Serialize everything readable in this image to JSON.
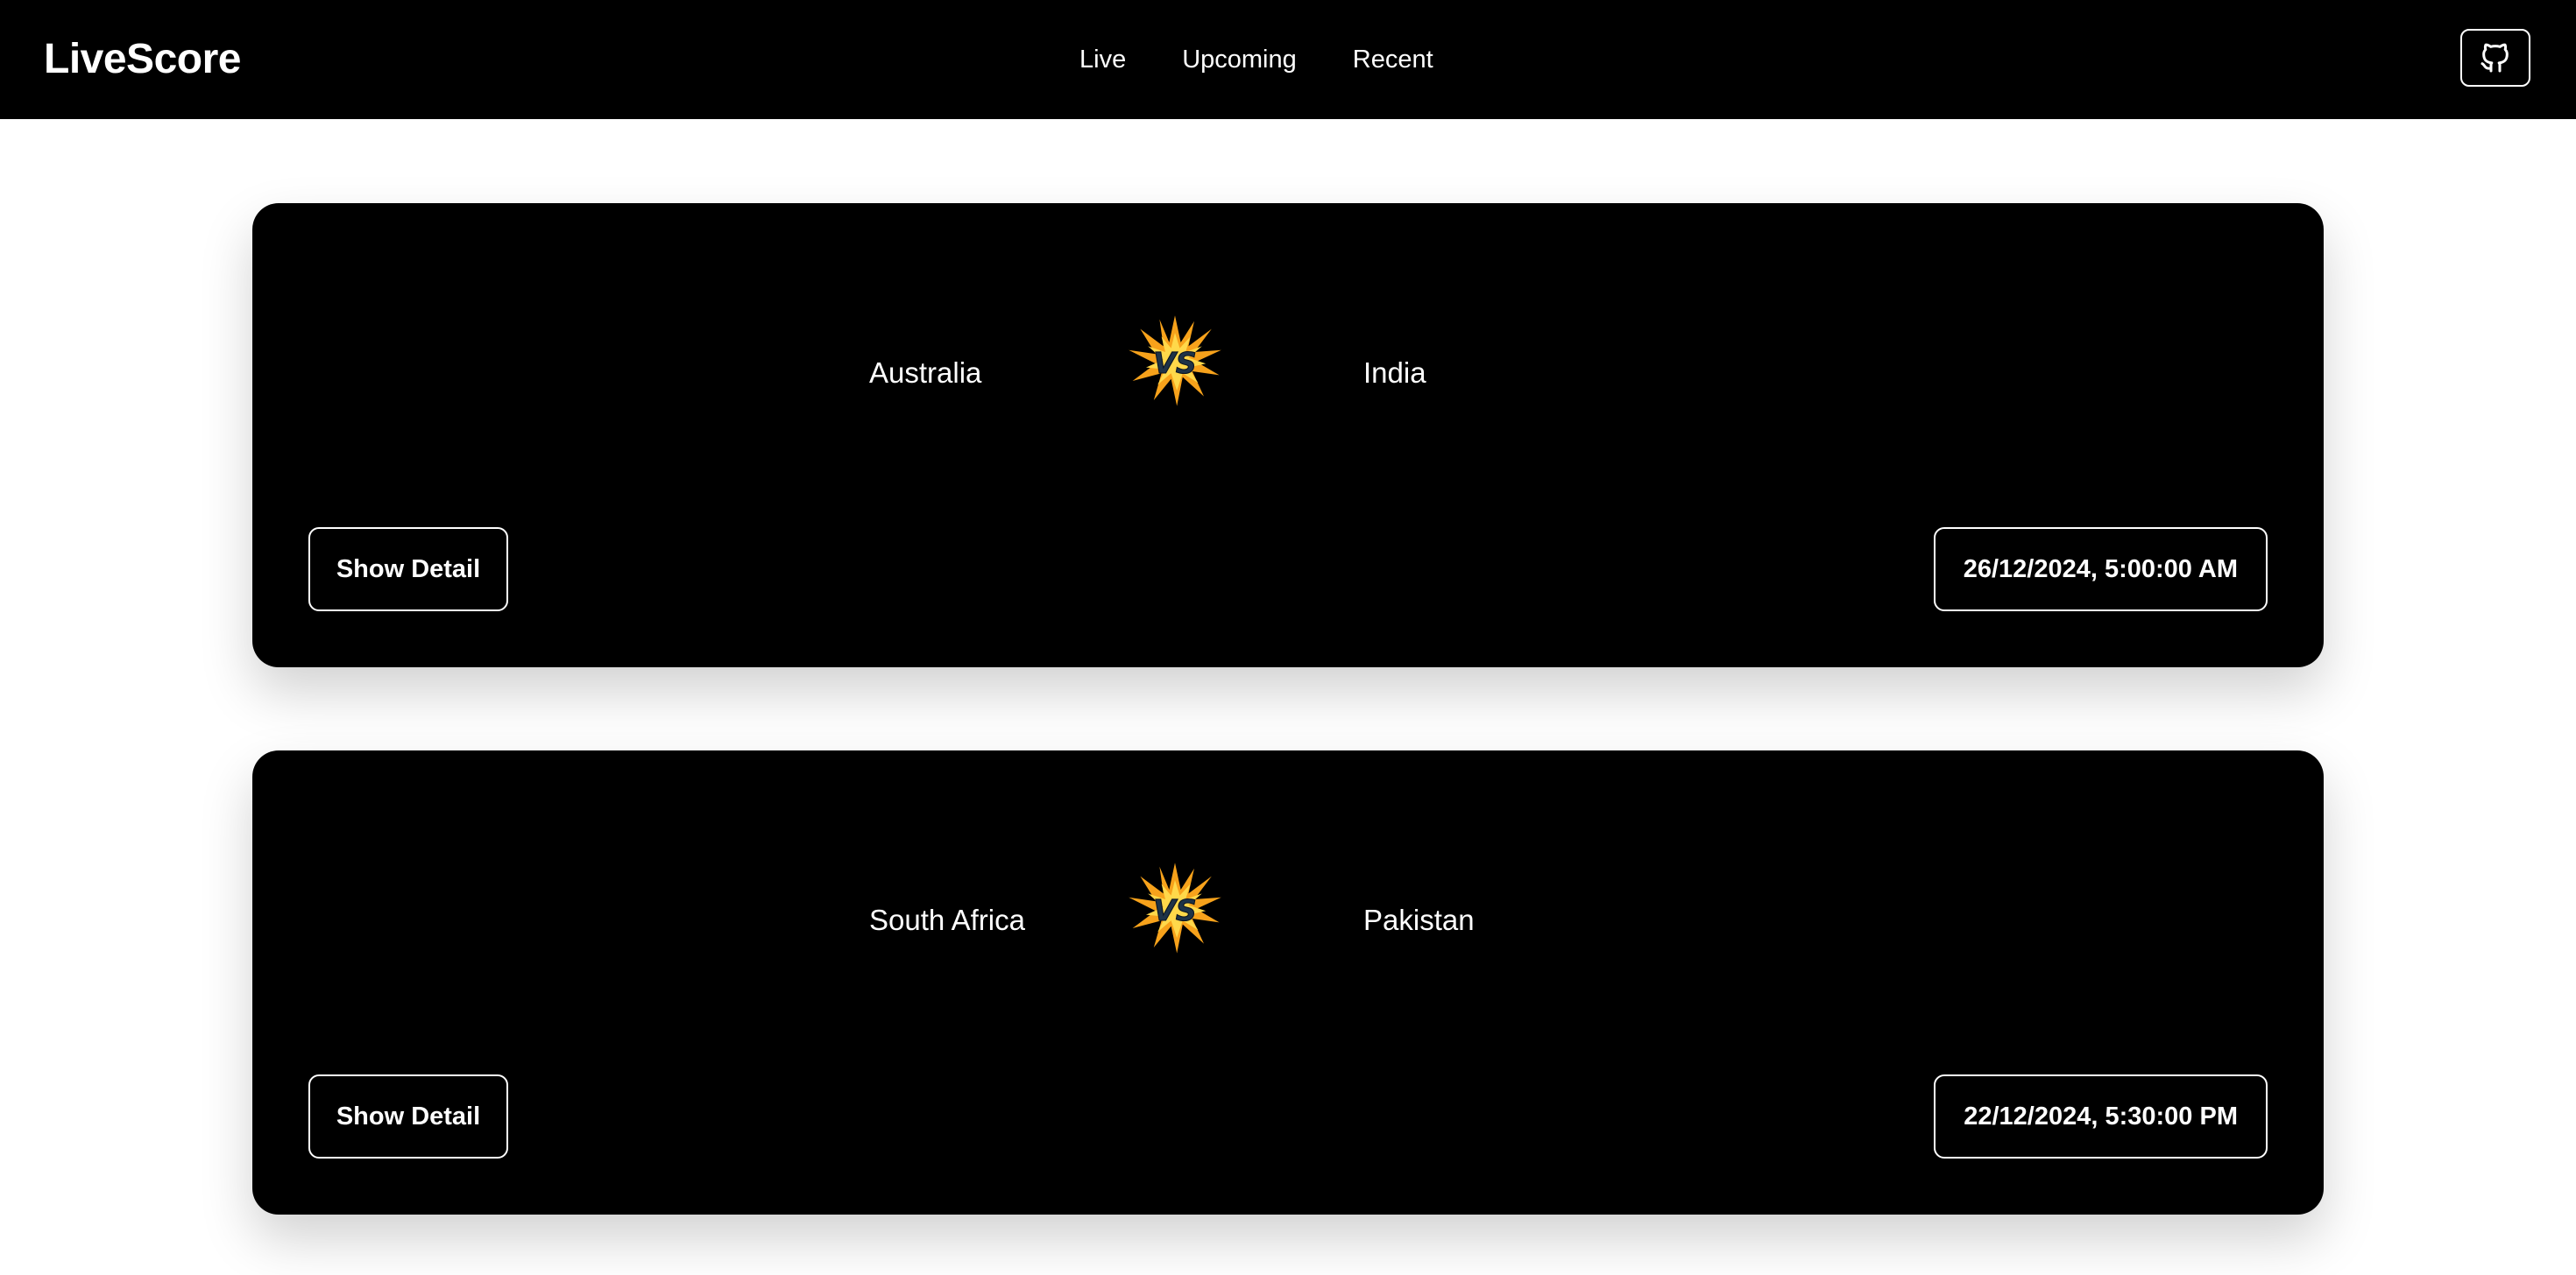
{
  "header": {
    "brand": "LiveScore",
    "nav": [
      {
        "label": "Live"
      },
      {
        "label": "Upcoming"
      },
      {
        "label": "Recent"
      }
    ],
    "github_icon": "github-icon"
  },
  "matches": [
    {
      "team_a": "Australia",
      "team_b": "India",
      "vs_icon": "vs-burst-icon",
      "detail_label": "Show Detail",
      "datetime": "26/12/2024, 5:00:00 AM"
    },
    {
      "team_a": "South Africa",
      "team_b": "Pakistan",
      "vs_icon": "vs-burst-icon",
      "detail_label": "Show Detail",
      "datetime": "22/12/2024, 5:30:00 PM"
    }
  ],
  "colors": {
    "background": "#ffffff",
    "card": "#000000",
    "text": "#ffffff",
    "vs_burst_outer": "#f7a21b",
    "vs_burst_inner": "#ffd84a"
  }
}
